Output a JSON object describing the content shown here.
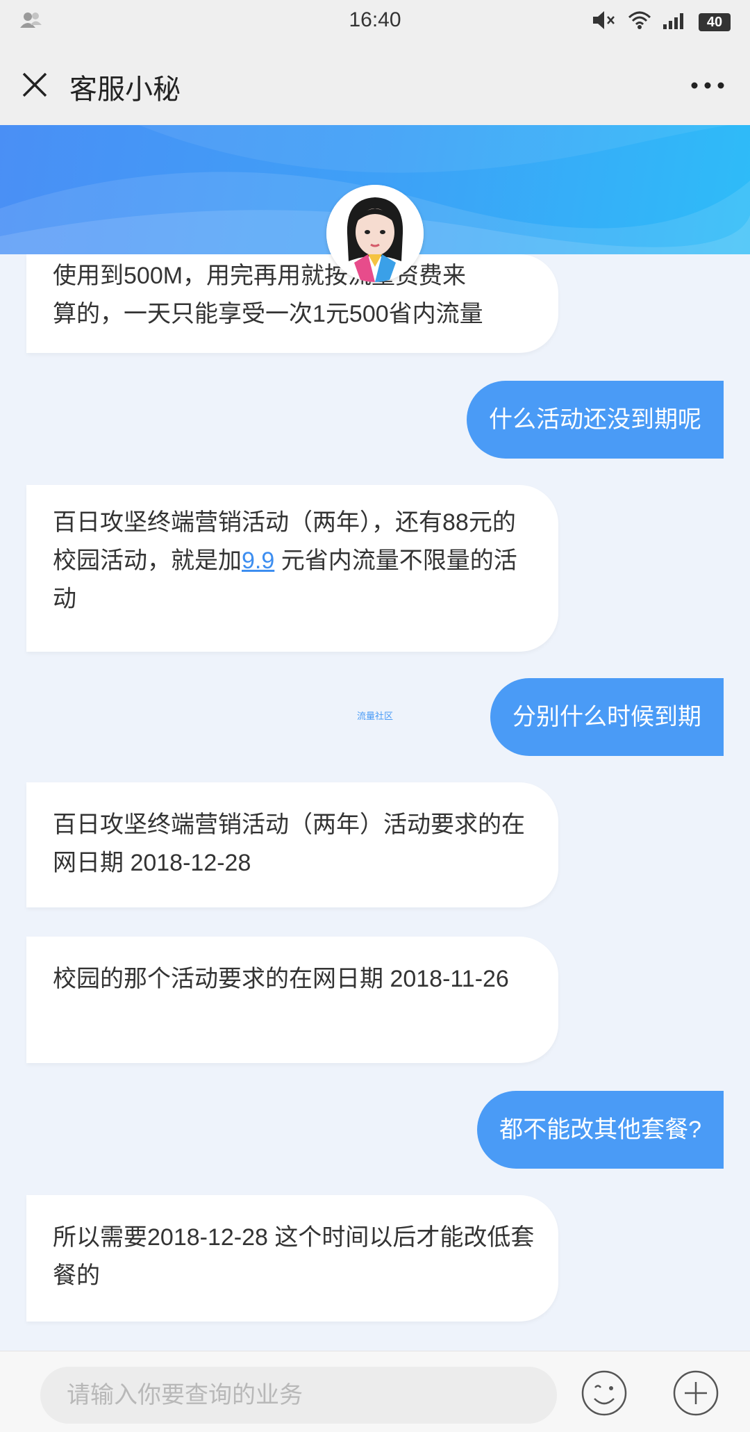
{
  "status_bar": {
    "time": "16:40",
    "battery": "40"
  },
  "header": {
    "title": "客服小秘"
  },
  "messages": [
    {
      "sender": "bot",
      "lines": [
        "使用到500M，用完再用就按流量资费来",
        "算的，一天只能享受一次1元500省内流量"
      ]
    },
    {
      "sender": "user",
      "text": "什么活动还没到期呢"
    },
    {
      "sender": "bot",
      "part1": "百日攻坚终端营销活动（两年），还有88元的校园活动，就是加",
      "link": "9.9",
      "part2": " 元省内流量不限量的活动"
    },
    {
      "sender": "user",
      "text": "分别什么时候到期"
    },
    {
      "sender": "bot",
      "text": " 百日攻坚终端营销活动（两年）活动要求的在网日期  2018-12-28"
    },
    {
      "sender": "bot",
      "text": "校园的那个活动要求的在网日期  2018-11-26"
    },
    {
      "sender": "user",
      "text": "都不能改其他套餐?"
    },
    {
      "sender": "bot",
      "text": "所以需要2018-12-28 这个时间以后才能改低套餐的"
    }
  ],
  "watermark": "流量社区",
  "input": {
    "placeholder": "请输入你要查询的业务"
  },
  "icons": [
    "person-icon",
    "mute-icon",
    "wifi-icon",
    "signal-icon",
    "close-icon",
    "more-icon",
    "emoji-icon",
    "plus-icon"
  ]
}
